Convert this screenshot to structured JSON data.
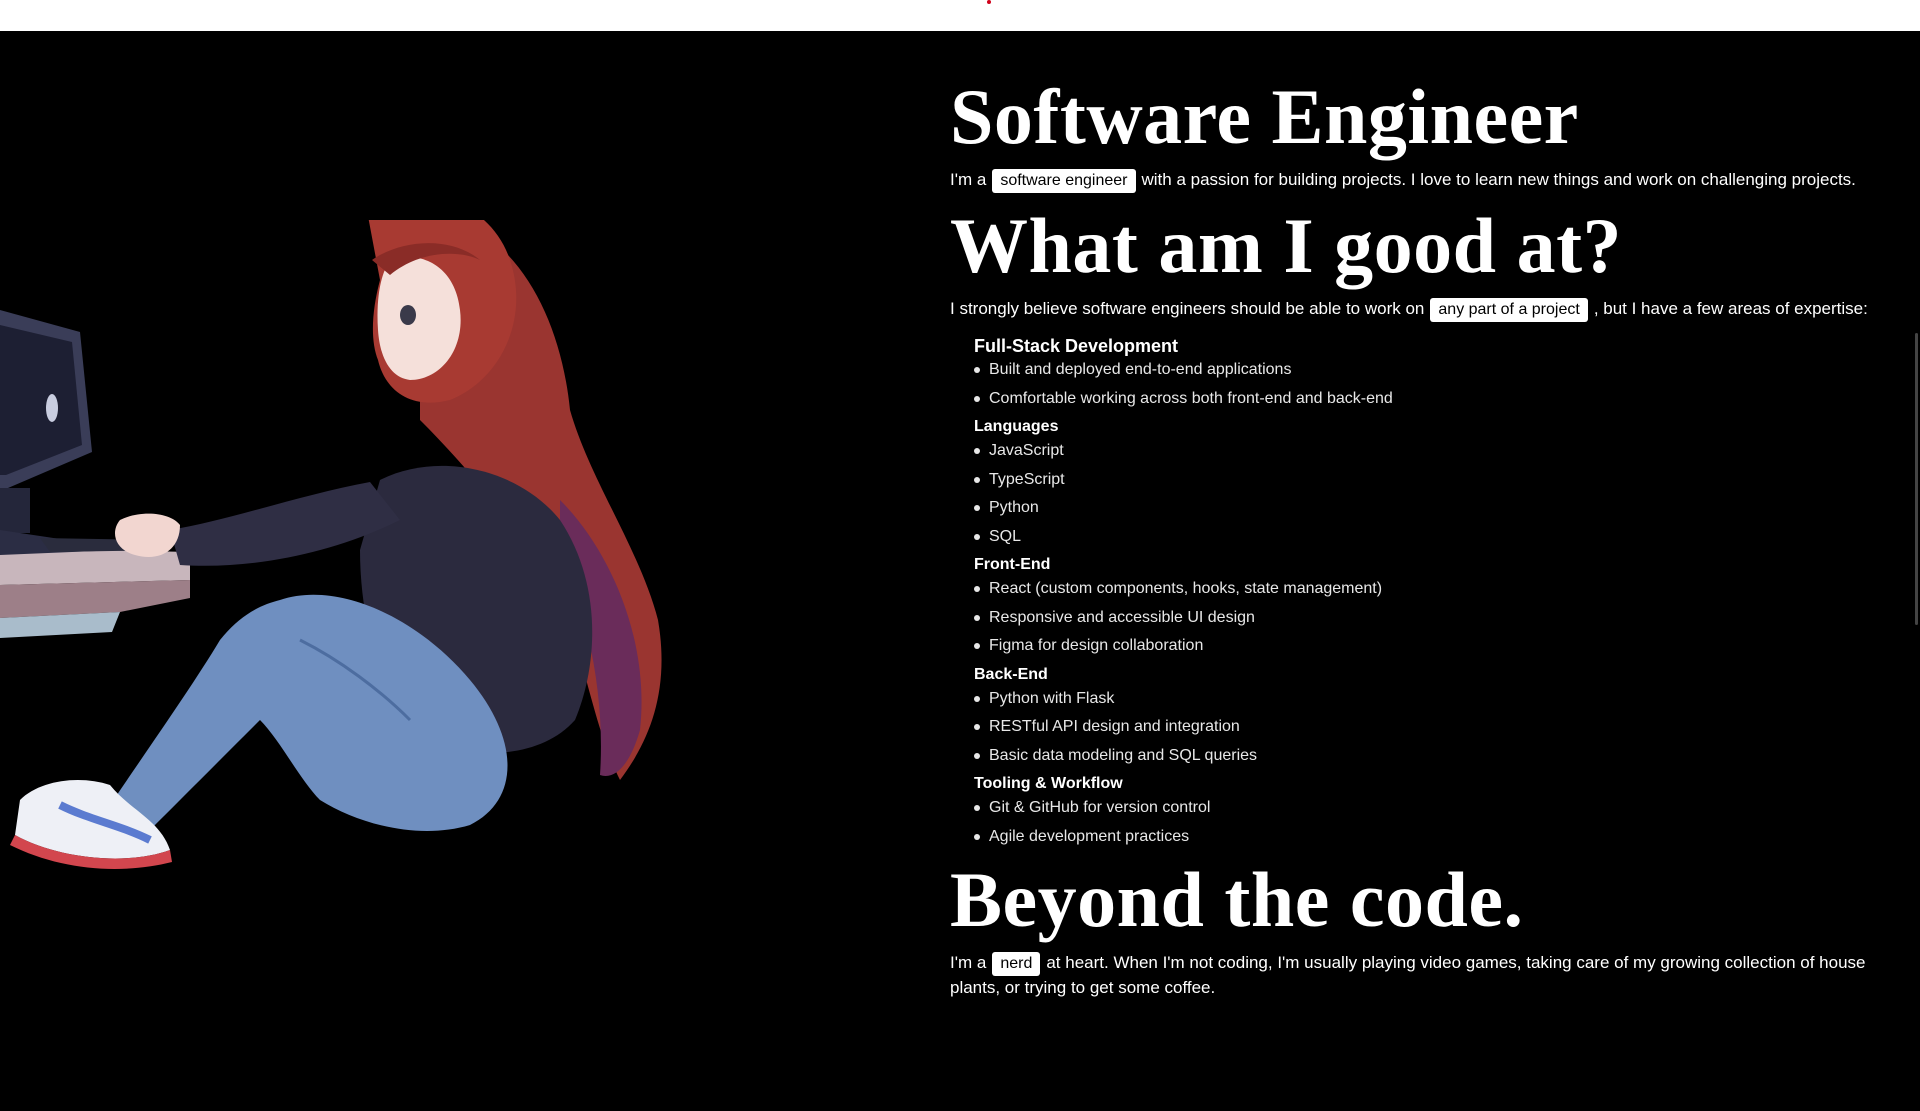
{
  "hero": {
    "title": "Software Engineer",
    "intro_before": "I'm a",
    "intro_chip": "software engineer",
    "intro_after": "with a passion for building projects. I love to learn new things and work on challenging projects."
  },
  "skills_section": {
    "title": "What am I good at?",
    "intro_before": "I strongly believe software engineers should be able to work on",
    "intro_chip": "any part of a project",
    "intro_after": ", but I have a few areas of expertise:",
    "groups": [
      {
        "title": "Full-Stack Development",
        "items": [
          "Built and deployed end-to-end applications",
          "Comfortable working across both front-end and back-end"
        ]
      },
      {
        "title": "Languages",
        "items": [
          "JavaScript",
          "TypeScript",
          "Python",
          "SQL"
        ]
      },
      {
        "title": "Front-End",
        "items": [
          "React (custom components, hooks, state management)",
          "Responsive and accessible UI design",
          "Figma for design collaboration"
        ]
      },
      {
        "title": "Back-End",
        "items": [
          "Python with Flask",
          "RESTful API design and integration",
          "Basic data modeling and SQL queries"
        ]
      },
      {
        "title": "Tooling & Workflow",
        "items": [
          "Git & GitHub for version control",
          "Agile development practices"
        ]
      }
    ]
  },
  "beyond": {
    "title": "Beyond the code.",
    "intro_before": "I'm a",
    "intro_chip": "nerd",
    "intro_after": "at heart. When I'm not coding, I'm usually playing video games, taking care of my growing collection of house plants, or trying to get some coffee."
  },
  "colors": {
    "background": "#000000",
    "text": "#ffffff",
    "chip_bg": "#ffffff",
    "chip_text": "#000000",
    "hair": "#a83a32",
    "jacket": "#2b2a3e",
    "jeans": "#6f8fc0"
  },
  "icons": {
    "illustration": "girl-coding-at-computer-illustration"
  }
}
